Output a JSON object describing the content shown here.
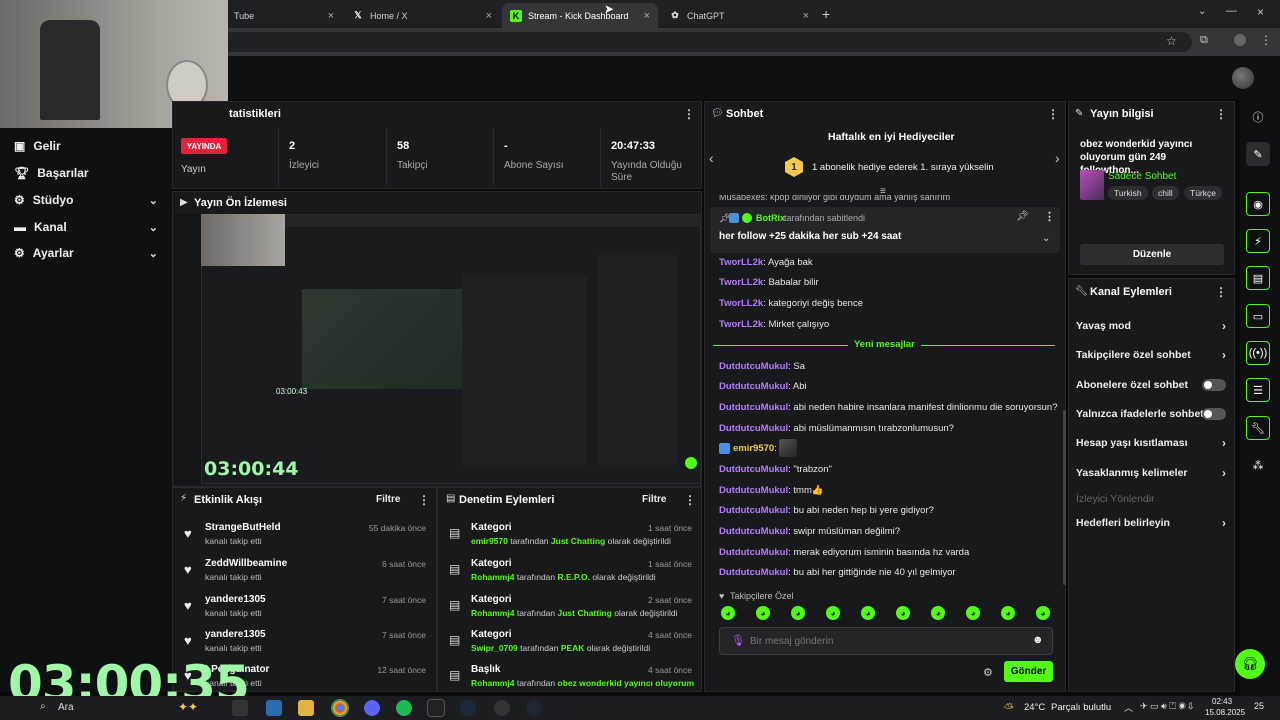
{
  "browser": {
    "tabs": [
      {
        "label": "Tube"
      },
      {
        "label": "Home / X"
      },
      {
        "label": "Stream - Kick Dashboard"
      },
      {
        "label": "ChatGPT"
      }
    ]
  },
  "sidebar": {
    "items": [
      {
        "label": "Gelir"
      },
      {
        "label": "Başarılar"
      },
      {
        "label": "Stüdyo"
      },
      {
        "label": "Kanal"
      },
      {
        "label": "Ayarlar"
      }
    ]
  },
  "stats": {
    "title": "tatistikleri",
    "live_badge": "YAYINDA",
    "live_label": "Yayın",
    "viewers_value": "2",
    "viewers_label": "İzleyici",
    "followers_value": "58",
    "followers_label": "Takipçi",
    "subs_value": "-",
    "subs_label": "Abone Sayısı",
    "duration_value": "20:47:33",
    "duration_label": "Yayında Olduğu Süre"
  },
  "preview": {
    "title": "Yayın Ön İzlemesi",
    "timer": "03:00:44",
    "small_timer": "03:00:43"
  },
  "activity": {
    "title": "Etkinlik Akışı",
    "filter": "Filtre",
    "items": [
      {
        "name": "StrangeButHeld",
        "sub": "kanalı takip etti",
        "time": "55 dakika önce"
      },
      {
        "name": "ZeddWillbeamine",
        "sub": "kanalı takip etti",
        "time": "6 saat önce"
      },
      {
        "name": "yandere1305",
        "sub": "kanalı takip etti",
        "time": "7 saat önce"
      },
      {
        "name": "yandere1305",
        "sub": "kanalı takip etti",
        "time": "7 saat önce"
      },
      {
        "name": "LPenguinator",
        "sub": "kanalı takip etti",
        "time": "12 saat önce"
      }
    ]
  },
  "moderation": {
    "title": "Denetim Eylemleri",
    "filter": "Filtre",
    "items": [
      {
        "name": "Kategori",
        "user": "emir9570",
        "mid": "tarafından",
        "target": "Just Chatting",
        "end": "olarak değiştirildi",
        "time": "1 saat önce"
      },
      {
        "name": "Kategori",
        "user": "Rohammj4",
        "mid": "tarafından",
        "target": "R.E.P.O.",
        "end": "olarak değiştirildi",
        "time": "1 saat önce"
      },
      {
        "name": "Kategori",
        "user": "Rohammj4",
        "mid": "tarafından",
        "target": "Just Chatting",
        "end": "olarak değiştirildi",
        "time": "2 saat önce"
      },
      {
        "name": "Kategori",
        "user": "Swipr_0709",
        "mid": "tarafından",
        "target": "PEAK",
        "end": "olarak değiştirildi",
        "time": "4 saat önce"
      },
      {
        "name": "Başlık",
        "user": "Rohammj4",
        "mid": "tarafından",
        "target": "obez wonderkid yayıncı oluyorum",
        "end": "",
        "time": "4 saat önce"
      }
    ]
  },
  "chat": {
    "title": "Sohbet",
    "gifters_title": "Haftalık en iyi Hediyeciler",
    "gifter_rank": "1",
    "gifter_text": "1 abonelik hediye ederek 1. sıraya yükselin",
    "clipped_msg": "Musabexes: kpop dinliyor gibi duydum ama yanlış sanırım",
    "pinned_by_user": "BotRix",
    "pinned_by_text": "tarafından sabitlendi",
    "pinned_text": "her follow +25 dakika her sub +24 saat",
    "new_messages": "Yeni mesajlar",
    "followers_only": "Takipçilere Özel",
    "input_placeholder": "Bir mesaj gönderin",
    "send": "Gönder",
    "messages": [
      {
        "user": "TworLL2k",
        "text": "Ayağa bak",
        "color": "#b77bff"
      },
      {
        "user": "TworLL2k",
        "text": "Babalar bilir",
        "color": "#b77bff"
      },
      {
        "user": "TworLL2k",
        "text": "kategoriyi değiş bence",
        "color": "#b77bff"
      },
      {
        "user": "TworLL2k",
        "text": "Mirket çalışıyo",
        "color": "#b77bff"
      },
      {
        "user": "DutdutcuMukul",
        "text": "Sa",
        "color": "#b77bff"
      },
      {
        "user": "DutdutcuMukul",
        "text": "Abi",
        "color": "#b77bff"
      },
      {
        "user": "DutdutcuMukul",
        "text": "abi neden habire insanlara manifest dinlionmu die soruyorsun?",
        "color": "#b77bff"
      },
      {
        "user": "DutdutcuMukul",
        "text": "abi müslümanmısın tırabzonlumusun?",
        "color": "#b77bff"
      },
      {
        "user": "emir9570",
        "text": "",
        "color": "#f2c94c"
      },
      {
        "user": "DutdutcuMukul",
        "text": "\"trabzon\"",
        "color": "#b77bff"
      },
      {
        "user": "DutdutcuMukul",
        "text": "tmm👍",
        "color": "#b77bff"
      },
      {
        "user": "DutdutcuMukul",
        "text": "bu abi neden hep bi yere gidiyor?",
        "color": "#b77bff"
      },
      {
        "user": "DutdutcuMukul",
        "text": "swipr müslüman değilmi?",
        "color": "#b77bff"
      },
      {
        "user": "DutdutcuMukul",
        "text": "merak ediyorum isminin basında hz varda",
        "color": "#b77bff"
      },
      {
        "user": "DutdutcuMukul",
        "text": "bu abi her gittiğinde nie 40 yıl gelmiyor",
        "color": "#b77bff"
      }
    ]
  },
  "stream_info": {
    "title": "Yayın bilgisi",
    "stream_title": "obez wonderkid yayıncı oluyorum gün 249 followthon...",
    "chat_mode": "Sadece Sohbet",
    "tags": [
      "Turkish",
      "chill",
      "Türkçe"
    ],
    "edit": "Düzenle"
  },
  "channel_actions": {
    "title": "Kanal Eylemleri",
    "items": [
      {
        "label": "Yavaş mod",
        "kind": "chevron"
      },
      {
        "label": "Takipçilere özel sohbet",
        "kind": "chevron"
      },
      {
        "label": "Abonelere özel sohbet",
        "kind": "toggle"
      },
      {
        "label": "Yalnızca ifadelerle sohbet",
        "kind": "toggle"
      },
      {
        "label": "Hesap yaşı kısıtlaması",
        "kind": "chevron"
      },
      {
        "label": "Yasaklanmış kelimeler",
        "kind": "chevron"
      },
      {
        "label": "İzleyici Yönlendir",
        "kind": "disabled"
      },
      {
        "label": "Hedefleri belirleyin",
        "kind": "chevron"
      }
    ]
  },
  "overlay": {
    "big_timer": "03:00:35"
  },
  "taskbar": {
    "search": "Ara",
    "weather": "24°C",
    "weather_text": "Parçalı bulutlu",
    "time": "02:43",
    "date": "15.08.2025",
    "notif": "25"
  },
  "colors": {
    "accent": "#53fc18",
    "live": "#e0223a",
    "username": "#b77bff"
  }
}
